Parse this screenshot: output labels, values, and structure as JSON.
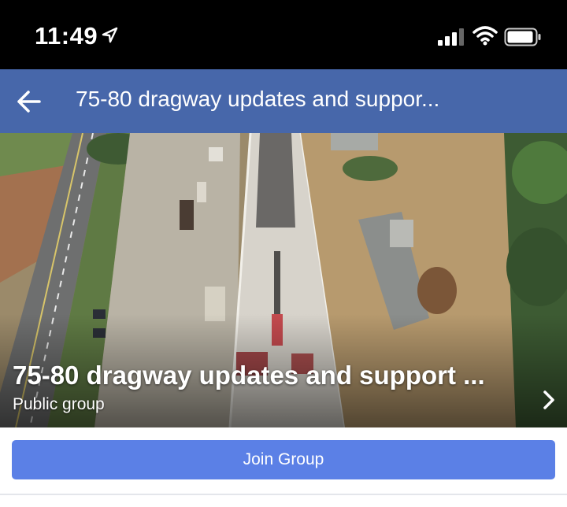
{
  "status_bar": {
    "time": "11:49",
    "icons": [
      "location-arrow-icon",
      "signal-icon",
      "wifi-icon",
      "battery-icon"
    ]
  },
  "header": {
    "title": "75-80 dragway updates and suppor...",
    "back_icon": "back-arrow-icon",
    "background_color": "#4767aa"
  },
  "cover": {
    "group_name": "75-80 dragway updates and support ...",
    "privacy": "Public group",
    "chevron_icon": "chevron-right-icon"
  },
  "join": {
    "label": "Join Group",
    "color": "#5b80e6"
  }
}
